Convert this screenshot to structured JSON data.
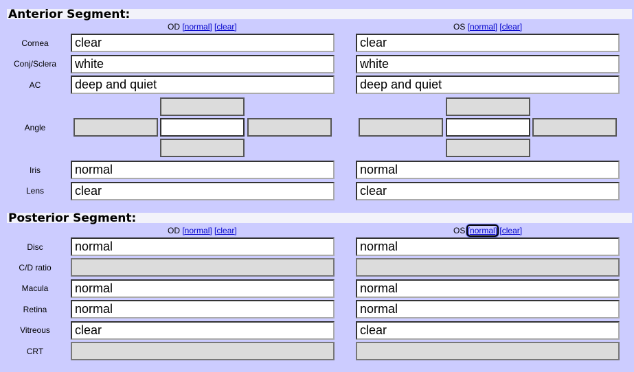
{
  "anterior": {
    "title": "Anterior Segment:",
    "od_label": "OD",
    "os_label": "OS",
    "normal_link": "[normal]",
    "clear_link": "[clear]",
    "rows": [
      {
        "label": "Cornea",
        "od": "clear",
        "os": "clear"
      },
      {
        "label": "Conj/Sclera",
        "od": "white",
        "os": "white"
      },
      {
        "label": "AC",
        "od": "deep and quiet",
        "os": "deep and quiet"
      },
      {
        "label": "Angle"
      },
      {
        "label": "Iris",
        "od": "normal",
        "os": "normal"
      },
      {
        "label": "Lens",
        "od": "clear",
        "os": "clear"
      }
    ]
  },
  "posterior": {
    "title": "Posterior Segment:",
    "od_label": "OD",
    "os_label": "OS",
    "normal_link": "[normal]",
    "clear_link": "[clear]",
    "rows": [
      {
        "label": "Disc",
        "od": "normal",
        "os": "normal"
      },
      {
        "label": "C/D ratio",
        "od": "",
        "os": ""
      },
      {
        "label": "Macula",
        "od": "normal",
        "os": "normal"
      },
      {
        "label": "Retina",
        "od": "normal",
        "os": "normal"
      },
      {
        "label": "Vitreous",
        "od": "clear",
        "os": "clear"
      },
      {
        "label": "CRT",
        "od": "",
        "os": ""
      }
    ]
  }
}
